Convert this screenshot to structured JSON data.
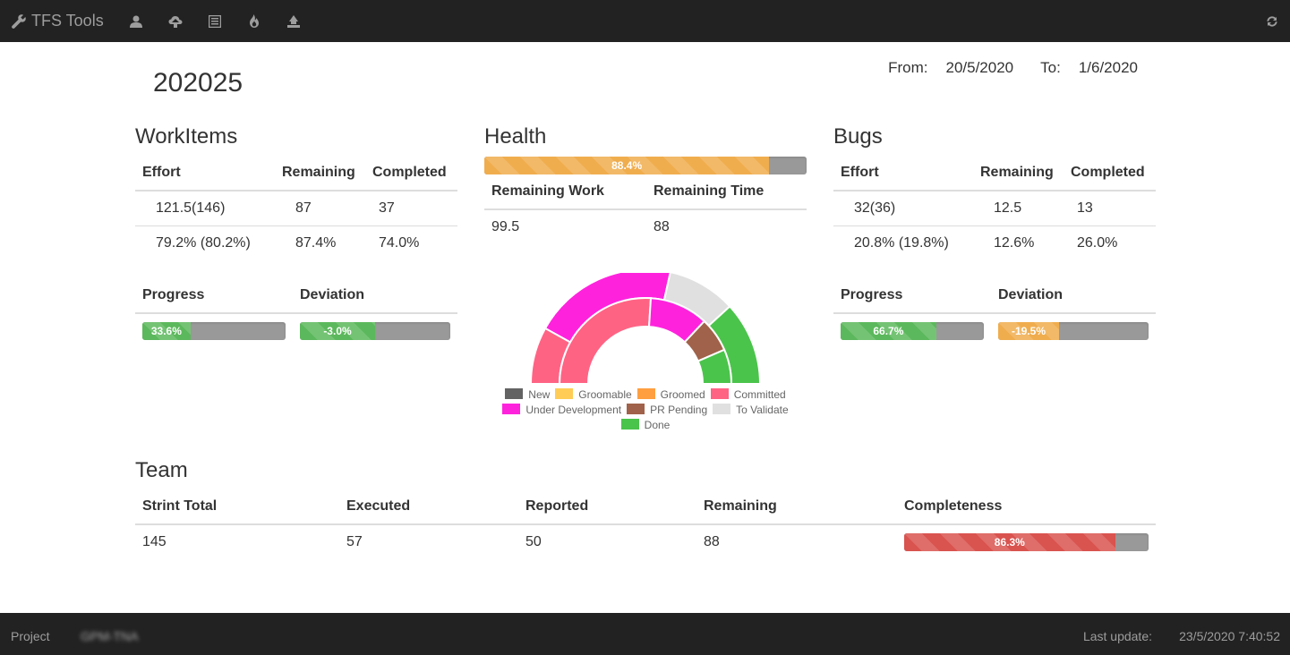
{
  "navbar": {
    "brand": "TFS Tools",
    "icons": [
      "user-icon",
      "cloud-upload-icon",
      "list-icon",
      "fire-icon",
      "eject-icon"
    ],
    "refresh_icon": "refresh-icon"
  },
  "header": {
    "sprint": "202025",
    "from_label": "From:",
    "from_value": "20/5/2020",
    "to_label": "To:",
    "to_value": "1/6/2020"
  },
  "workitems": {
    "title": "WorkItems",
    "headers": [
      "Effort",
      "Remaining",
      "Completed"
    ],
    "rows": [
      [
        "121.5(146)",
        "87",
        "37"
      ],
      [
        "79.2% (80.2%)",
        "87.4%",
        "74.0%"
      ]
    ],
    "progress_label": "Progress",
    "deviation_label": "Deviation",
    "progress": {
      "value": 33.6,
      "text": "33.6%",
      "color": "#5cb85c"
    },
    "deviation": {
      "value": 50,
      "text": "-3.0%",
      "color": "#5cb85c"
    }
  },
  "health": {
    "title": "Health",
    "bar": {
      "value": 88.4,
      "text": "88.4%",
      "color": "#f0ad4e"
    },
    "headers": [
      "Remaining Work",
      "Remaining Time"
    ],
    "rows": [
      [
        "99.5",
        "88"
      ]
    ]
  },
  "bugs": {
    "title": "Bugs",
    "headers": [
      "Effort",
      "Remaining",
      "Completed"
    ],
    "rows": [
      [
        "32(36)",
        "12.5",
        "13"
      ],
      [
        "20.8% (19.8%)",
        "12.6%",
        "26.0%"
      ]
    ],
    "progress_label": "Progress",
    "deviation_label": "Deviation",
    "progress": {
      "value": 66.7,
      "text": "66.7%",
      "color": "#5cb85c"
    },
    "deviation": {
      "value": 40.5,
      "text": "-19.5%",
      "color": "#f0ad4e"
    }
  },
  "chart_data": {
    "type": "pie",
    "variant": "half-doughnut",
    "legend": [
      {
        "name": "New",
        "color": "#636363"
      },
      {
        "name": "Groomable",
        "color": "#ffcd56"
      },
      {
        "name": "Groomed",
        "color": "#ff9f40"
      },
      {
        "name": "Committed",
        "color": "#ff6384"
      },
      {
        "name": "Under Development",
        "color": "#ff22dd"
      },
      {
        "name": "PR Pending",
        "color": "#a0624a"
      },
      {
        "name": "To Validate",
        "color": "#e0e0e0"
      },
      {
        "name": "Done",
        "color": "#4bc44b"
      }
    ],
    "series": [
      {
        "ring": "outer",
        "values": [
          0,
          0,
          0,
          15,
          38,
          18,
          0,
          22
        ],
        "order": [
          "New",
          "Groomable",
          "Groomed",
          "Committed",
          "Under Development",
          "To Validate",
          "PR Pending",
          "Done"
        ]
      },
      {
        "ring": "inner",
        "values": [
          0,
          0,
          0,
          52,
          22,
          0,
          13,
          13
        ],
        "order": [
          "New",
          "Groomable",
          "Groomed",
          "Committed",
          "Under Development",
          "To Validate",
          "PR Pending",
          "Done"
        ]
      }
    ]
  },
  "team": {
    "title": "Team",
    "headers": [
      "Strint Total",
      "Executed",
      "Reported",
      "Remaining",
      "Completeness"
    ],
    "rows": [
      [
        "145",
        "57",
        "50",
        "88"
      ]
    ],
    "completeness": {
      "value": 86.3,
      "text": "86.3%",
      "color": "#d9534f"
    }
  },
  "footer": {
    "project_label": "Project",
    "project_name": "GPM-TNA",
    "last_update_label": "Last update:",
    "last_update_value": "23/5/2020 7:40:52"
  }
}
